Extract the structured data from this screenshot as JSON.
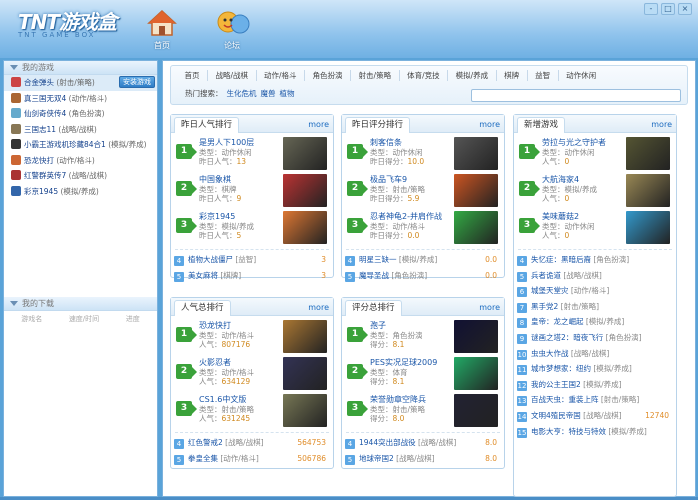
{
  "app": {
    "logo": "TNT游戏盒",
    "logo_sub": "TNT GAME BOX",
    "nav": [
      {
        "label": "首页",
        "color": "#e07a3b"
      },
      {
        "label": "论坛",
        "color": "#f2b030"
      }
    ],
    "win": [
      "-",
      "□",
      "×"
    ]
  },
  "sidebar": {
    "my_games": "我的游戏",
    "install_label": "安装游戏",
    "games": [
      {
        "name": "合金弹头",
        "type": "(射击/策略)",
        "color": "#c44"
      },
      {
        "name": "真三国无双4",
        "type": "(动作/格斗)",
        "color": "#a63"
      },
      {
        "name": "仙剑奇侠传4",
        "type": "(角色扮演)",
        "color": "#6ac"
      },
      {
        "name": "三国志11",
        "type": "(战略/战棋)",
        "color": "#875"
      },
      {
        "name": "小霸王游戏机珍藏84合1",
        "type": "(模拟/养成)",
        "color": "#333"
      },
      {
        "name": "恐龙快打",
        "type": "(动作/格斗)",
        "color": "#c63"
      },
      {
        "name": "红警群英传7",
        "type": "(战略/战棋)",
        "color": "#a33"
      },
      {
        "name": "彩京1945",
        "type": "(模拟/养成)",
        "color": "#36a"
      }
    ],
    "downloads": "我的下载",
    "dl_cols": [
      "游戏名",
      "速度/时间",
      "进度"
    ]
  },
  "main": {
    "categories": [
      "首页",
      "战略/战棋",
      "动作/格斗",
      "角色扮演",
      "射击/策略",
      "体育/竞技",
      "模拟/养成",
      "棋牌",
      "益智",
      "动作休闲"
    ],
    "hot_label": "热门搜索：",
    "hot": [
      "生化危机",
      "魔兽",
      "植物"
    ],
    "panels": [
      {
        "title": "昨日人气排行",
        "more": "more",
        "top": [
          {
            "name": "是男人下100层",
            "type": "类型：动作休闲",
            "pop_label": "昨日人气：",
            "pop": "13",
            "color": "#665"
          },
          {
            "name": "中国象棋",
            "type": "类型：棋牌",
            "pop_label": "昨日人气：",
            "pop": "9",
            "color": "#b33"
          },
          {
            "name": "彩京1945",
            "type": "类型：模拟/养成",
            "pop_label": "昨日人气：",
            "pop": "5",
            "color": "#d73"
          }
        ],
        "rows": [
          {
            "n": "4",
            "name": "植物大战僵尸",
            "type": "[益智]",
            "val": "3"
          },
          {
            "n": "5",
            "name": "美女麻将",
            "type": "[棋牌]",
            "val": "3"
          }
        ]
      },
      {
        "title": "昨日评分排行",
        "more": "more",
        "top": [
          {
            "name": "刺客信条",
            "type": "类型：动作休闲",
            "pop_label": "昨日得分：",
            "pop": "10.0",
            "color": "#555"
          },
          {
            "name": "极品飞车9",
            "type": "类型：射击/策略",
            "pop_label": "昨日得分：",
            "pop": "5.9",
            "color": "#c52"
          },
          {
            "name": "忍者神龟2-并肩作战",
            "type": "类型：动作/格斗",
            "pop_label": "昨日得分：",
            "pop": "0.0",
            "color": "#3a4"
          }
        ],
        "rows": [
          {
            "n": "4",
            "name": "明星三缺一",
            "type": "[模拟/养成]",
            "val": "0.0"
          },
          {
            "n": "5",
            "name": "魔导圣战",
            "type": "[角色扮演]",
            "val": "0.0"
          }
        ]
      },
      {
        "title": "新增游戏",
        "more": "more",
        "top": [
          {
            "name": "劳拉与光之守护者",
            "type": "类型：动作休闲",
            "pop_label": "人气：",
            "pop": "0",
            "color": "#553"
          },
          {
            "name": "大航海家4",
            "type": "类型：模拟/养成",
            "pop_label": "人气：",
            "pop": "0",
            "color": "#985"
          },
          {
            "name": "美味蘑菇2",
            "type": "类型：动作休闲",
            "pop_label": "人气：",
            "pop": "0",
            "color": "#39c"
          }
        ],
        "rows": [
          {
            "n": "4",
            "name": "失忆症：黑暗后裔",
            "type": "[角色扮演]",
            "val": ""
          },
          {
            "n": "5",
            "name": "兵者诡道",
            "type": "[战略/战棋]",
            "val": ""
          },
          {
            "n": "6",
            "name": "城堡天堂灾",
            "type": "[动作/格斗]",
            "val": ""
          },
          {
            "n": "7",
            "name": "黑手党2",
            "type": "[射击/策略]",
            "val": ""
          },
          {
            "n": "8",
            "name": "皇帝：龙之崛起",
            "type": "[模拟/养成]",
            "val": ""
          },
          {
            "n": "9",
            "name": "谜画之塔2：暗夜飞行",
            "type": "[角色扮演]",
            "val": ""
          },
          {
            "n": "10",
            "name": "虫虫大作战",
            "type": "[战略/战棋]",
            "val": ""
          },
          {
            "n": "11",
            "name": "城市梦想家：纽约",
            "type": "[模拟/养成]",
            "val": ""
          },
          {
            "n": "12",
            "name": "我的公主王国2",
            "type": "[模拟/养成]",
            "val": ""
          },
          {
            "n": "13",
            "name": "百战天虫：重装上阵",
            "type": "[射击/策略]",
            "val": ""
          },
          {
            "n": "14",
            "name": "文明4殖民帝国",
            "type": "[战略/战棋]",
            "val": "12740"
          },
          {
            "n": "15",
            "name": "电影大亨：特技与特效",
            "type": "[模拟/养成]",
            "val": ""
          }
        ]
      },
      {
        "title": "人气总排行",
        "more": "more",
        "top": [
          {
            "name": "恐龙快打",
            "type": "类型：动作/格斗",
            "pop_label": "人气：",
            "pop": "807176",
            "color": "#a73"
          },
          {
            "name": "火影忍者",
            "type": "类型：动作/格斗",
            "pop_label": "人气：",
            "pop": "634129",
            "color": "#335"
          },
          {
            "name": "CS1.6中文版",
            "type": "类型：射击/策略",
            "pop_label": "人气：",
            "pop": "631245",
            "color": "#775"
          }
        ],
        "rows": [
          {
            "n": "4",
            "name": "红色警戒2",
            "type": "[战略/战棋]",
            "val": "564753"
          },
          {
            "n": "5",
            "name": "拳皇全集",
            "type": "[动作/格斗]",
            "val": "506786"
          }
        ]
      },
      {
        "title": "评分总排行",
        "more": "more",
        "top": [
          {
            "name": "孢子",
            "type": "类型：角色扮演",
            "pop_label": "得分：",
            "pop": "8.1",
            "color": "#113"
          },
          {
            "name": "PES实况足球2009",
            "type": "类型：体育",
            "pop_label": "得分：",
            "pop": "8.1",
            "color": "#2a6"
          },
          {
            "name": "荣誉勋章空降兵",
            "type": "类型：射击/策略",
            "pop_label": "得分：",
            "pop": "8.0",
            "color": "#223"
          }
        ],
        "rows": [
          {
            "n": "4",
            "name": "1944突出部战役",
            "type": "[战略/战棋]",
            "val": "8.0"
          },
          {
            "n": "5",
            "name": "地球帝国2",
            "type": "[战略/战棋]",
            "val": "8.0"
          }
        ]
      }
    ]
  }
}
